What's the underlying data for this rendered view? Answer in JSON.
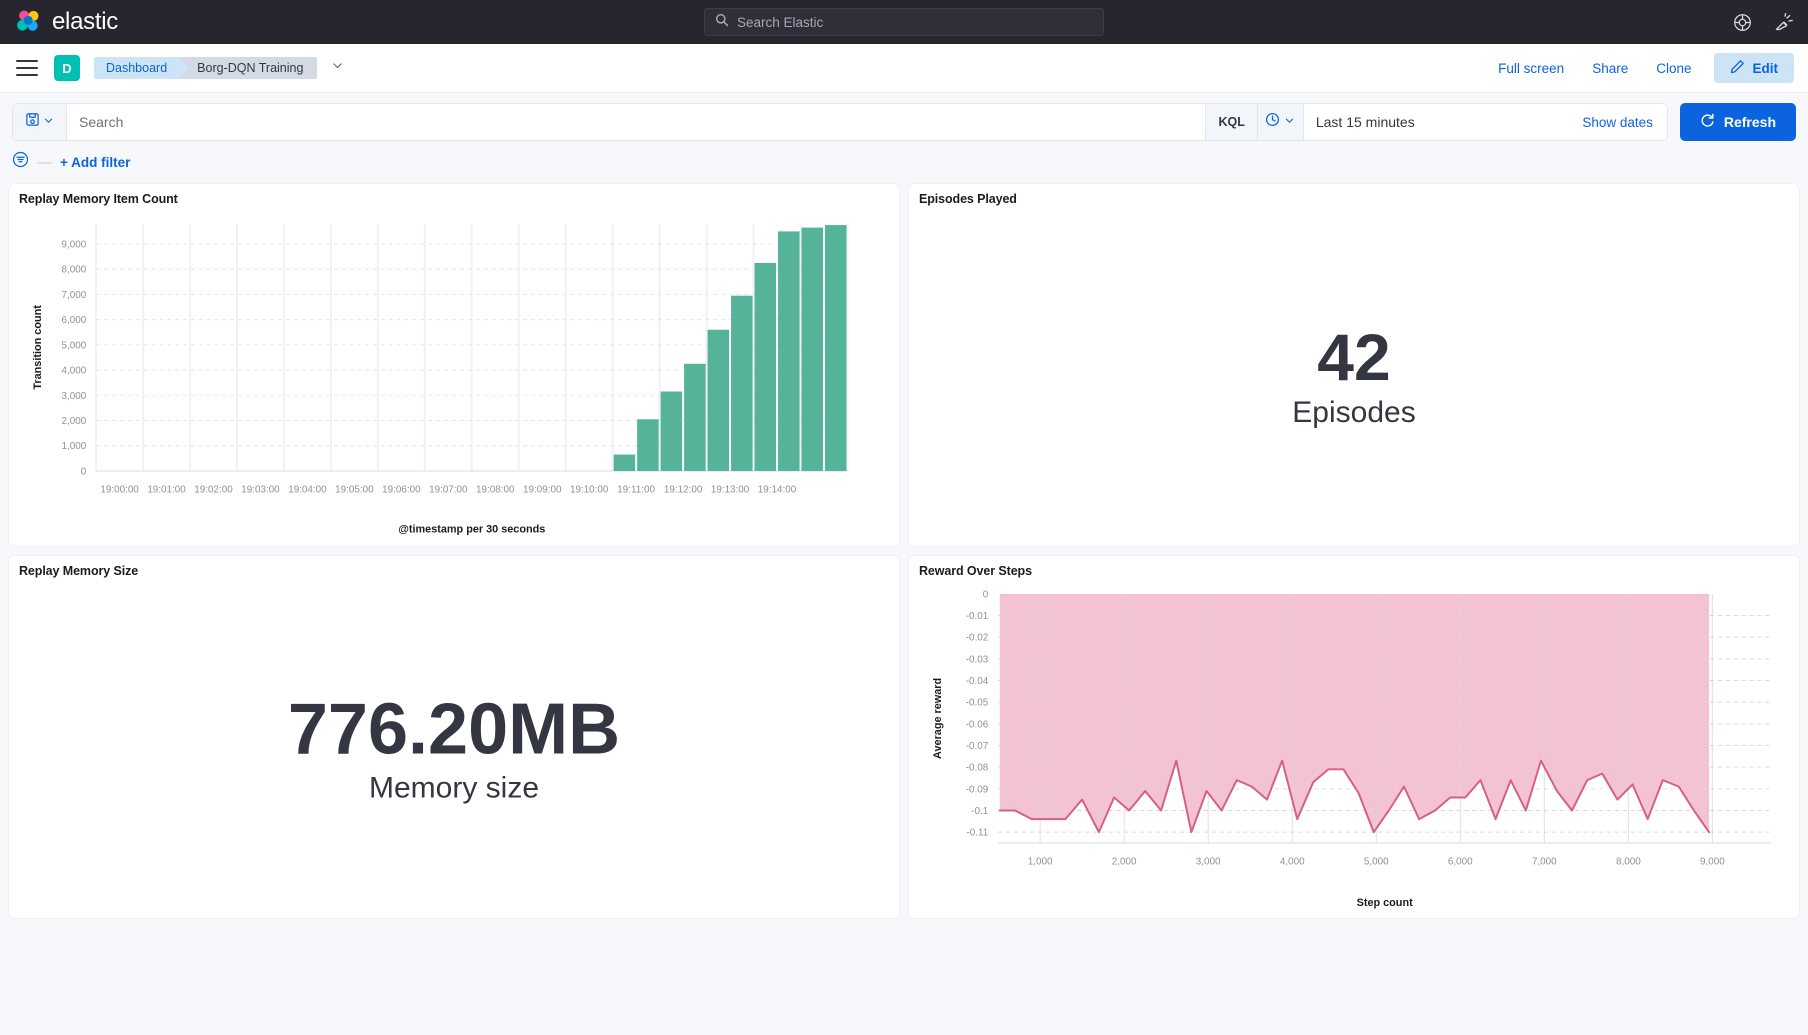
{
  "header": {
    "brand": "elastic",
    "search_placeholder": "Search Elastic",
    "icons": {
      "help": "lifebuoy-icon",
      "whats_new": "announcement-icon"
    }
  },
  "breadcrumb": {
    "space_initial": "D",
    "crumb_dashboard": "Dashboard",
    "crumb_current": "Borg-DQN Training",
    "actions": {
      "full_screen": "Full screen",
      "share": "Share",
      "clone": "Clone",
      "edit": "Edit"
    }
  },
  "query_bar": {
    "search_placeholder": "Search",
    "search_value": "",
    "language_badge": "KQL",
    "date_range": "Last 15 minutes",
    "show_dates": "Show dates",
    "refresh": "Refresh"
  },
  "filter_bar": {
    "add_filter": "+ Add filter"
  },
  "panels": {
    "replay_memory_item_count": {
      "title": "Replay Memory Item Count"
    },
    "episodes_played": {
      "title": "Episodes Played",
      "value": "42",
      "label": "Episodes"
    },
    "replay_memory_size": {
      "title": "Replay Memory Size",
      "value": "776.20MB",
      "label": "Memory size"
    },
    "reward_over_steps": {
      "title": "Reward Over Steps"
    }
  },
  "chart_data": [
    {
      "type": "bar",
      "title": "Replay Memory Item Count",
      "xlabel": "@timestamp per 30 seconds",
      "ylabel": "Transition count",
      "ylim": [
        0,
        9800
      ],
      "grid": true,
      "yticks": [
        0,
        1000,
        2000,
        3000,
        4000,
        5000,
        6000,
        7000,
        8000,
        9000
      ],
      "ytick_labels": [
        "0",
        "1,000",
        "2,000",
        "3,000",
        "4,000",
        "5,000",
        "6,000",
        "7,000",
        "8,000",
        "9,000"
      ],
      "xtick_labels": [
        "19:00:00",
        "19:01:00",
        "19:02:00",
        "19:03:00",
        "19:04:00",
        "19:05:00",
        "19:06:00",
        "19:07:00",
        "19:08:00",
        "19:09:00",
        "19:10:00",
        "19:11:00",
        "19:12:00",
        "19:13:00",
        "19:14:00"
      ],
      "categories": [
        "19:00:00",
        "19:00:30",
        "19:01:00",
        "19:01:30",
        "19:02:00",
        "19:02:30",
        "19:03:00",
        "19:03:30",
        "19:04:00",
        "19:04:30",
        "19:05:00",
        "19:05:30",
        "19:06:00",
        "19:06:30",
        "19:07:00",
        "19:07:30",
        "19:08:00",
        "19:08:30",
        "19:09:00",
        "19:09:30",
        "19:10:00",
        "19:10:30",
        "19:11:00",
        "19:11:30",
        "19:12:00",
        "19:12:30",
        "19:13:00",
        "19:13:30",
        "19:14:00",
        "19:14:30"
      ],
      "values": [
        0,
        0,
        0,
        0,
        0,
        0,
        0,
        0,
        0,
        0,
        0,
        0,
        0,
        0,
        0,
        0,
        0,
        0,
        0,
        0,
        0,
        0,
        650,
        2050,
        3150,
        4250,
        5600,
        6950,
        8250,
        9500,
        9650,
        9750
      ],
      "series_color": "#54B399"
    },
    {
      "type": "area",
      "title": "Reward Over Steps",
      "xlabel": "Step count",
      "ylabel": "Average reward",
      "ylim": [
        -0.115,
        0
      ],
      "xlim": [
        500,
        9700
      ],
      "grid": true,
      "yticks": [
        0,
        -0.01,
        -0.02,
        -0.03,
        -0.04,
        -0.05,
        -0.06,
        -0.07,
        -0.08,
        -0.09,
        -0.1,
        -0.11
      ],
      "ytick_labels": [
        "0",
        "-0.01",
        "-0.02",
        "-0.03",
        "-0.04",
        "-0.05",
        "-0.06",
        "-0.07",
        "-0.08",
        "-0.09",
        "-0.1",
        "-0.11"
      ],
      "xticks": [
        1000,
        2000,
        3000,
        4000,
        5000,
        6000,
        7000,
        8000,
        9000
      ],
      "xtick_labels": [
        "1,000",
        "2,000",
        "3,000",
        "4,000",
        "5,000",
        "6,000",
        "7,000",
        "8,000",
        "9,000"
      ],
      "line_color": "#D36086",
      "fill_color": "#F3C3D2",
      "x": [
        520,
        700,
        900,
        1100,
        1300,
        1500,
        1700,
        1880,
        2060,
        2250,
        2440,
        2620,
        2800,
        2980,
        3160,
        3340,
        3520,
        3700,
        3880,
        4060,
        4250,
        4430,
        4610,
        4790,
        4970,
        5150,
        5330,
        5510,
        5700,
        5880,
        6060,
        6240,
        6420,
        6600,
        6780,
        6960,
        7150,
        7330,
        7510,
        7690,
        7870,
        8050,
        8230,
        8410,
        8600,
        8780,
        8960,
        9140,
        9320,
        9500,
        9650
      ],
      "y": [
        -0.1,
        -0.1,
        -0.104,
        -0.104,
        -0.104,
        -0.095,
        -0.11,
        -0.094,
        -0.1,
        -0.091,
        -0.1,
        -0.077,
        -0.11,
        -0.091,
        -0.1,
        -0.086,
        -0.089,
        -0.095,
        -0.077,
        -0.104,
        -0.087,
        -0.081,
        -0.081,
        -0.092,
        -0.11,
        -0.1,
        -0.089,
        -0.104,
        -0.1,
        -0.094,
        -0.094,
        -0.086,
        -0.104,
        -0.086,
        -0.1,
        -0.077,
        -0.091,
        -0.1,
        -0.086,
        -0.083,
        -0.095,
        -0.088,
        -0.104,
        -0.086,
        -0.089,
        -0.1,
        -0.11
      ]
    }
  ]
}
